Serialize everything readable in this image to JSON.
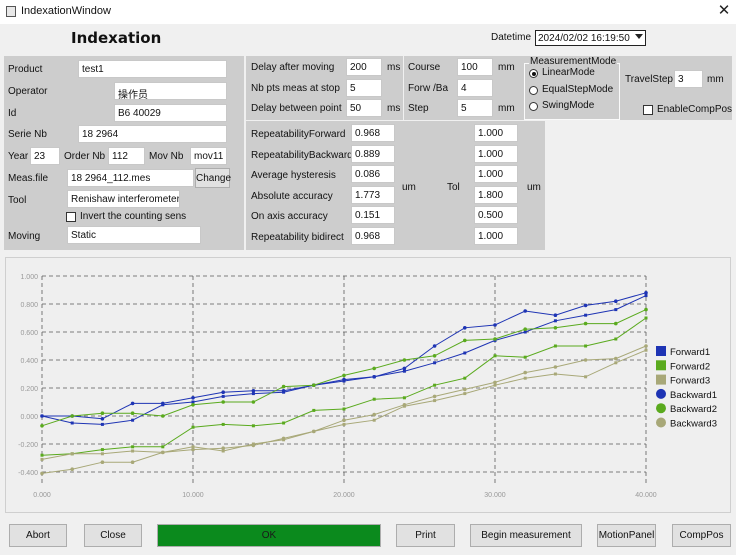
{
  "window": {
    "title": "IndexationWindow",
    "close_glyph": "✕"
  },
  "heading": "Indexation",
  "datetime": {
    "label": "Datetime",
    "value": "2024/02/02 16:19:50"
  },
  "left": {
    "product_label": "Product",
    "product_value": "test1",
    "operator_label": "Operator",
    "operator_value": "操作员",
    "id_label": "Id",
    "id_value": "B6 40029",
    "serie_label": "Serie Nb",
    "serie_value": "18 2964",
    "year_label": "Year",
    "year_value": "23",
    "order_label": "Order Nb",
    "order_value": "112",
    "mov_label": "Mov Nb",
    "mov_value": "mov11",
    "meas_label": "Meas.file",
    "meas_value": "18 2964_112.mes",
    "change_label": "Change",
    "tool_label": "Tool",
    "tool_value": "Renishaw interferometer",
    "invert_label": "Invert the counting sens",
    "invert_checked": false,
    "moving_label": "Moving",
    "moving_value": "Static"
  },
  "params": {
    "delay_moving_label": "Delay after moving",
    "delay_moving_value": "200",
    "nbpts_label": "Nb pts meas at stop",
    "nbpts_value": "5",
    "delay_points_label": "Delay between point",
    "delay_points_value": "50",
    "unit_ms": "ms",
    "course_label": "Course",
    "course_value": "100",
    "forw_label": "Forw  /Ba",
    "forw_value": "4",
    "step_label": "Step",
    "step_value": "5",
    "unit_mm": "mm"
  },
  "mode": {
    "group_label": "MeasurementMode",
    "options": [
      "LinearMode",
      "EqualStepMode",
      "SwingMode"
    ],
    "selected": "LinearMode",
    "travelstep_label": "TravelStep",
    "travelstep_value": "3",
    "travelstep_unit": "mm",
    "enablecomp_label": "EnableCompPos",
    "enablecomp_checked": false
  },
  "results": {
    "rows": [
      {
        "label": "RepeatabilityForward",
        "value": "0.968",
        "tol": "1.000"
      },
      {
        "label": "RepeatabilityBackward",
        "value": "0.889",
        "tol": "1.000"
      },
      {
        "label": "Average hysteresis",
        "value": "0.086",
        "tol": "1.000"
      },
      {
        "label": "Absolute accuracy",
        "value": "1.773",
        "tol": "1.800"
      },
      {
        "label": "On axis accuracy",
        "value": "0.151",
        "tol": "0.500"
      },
      {
        "label": "Repeatability bidirect",
        "value": "0.968",
        "tol": "1.000"
      }
    ],
    "unit": "um",
    "tol_label": "Tol",
    "tol_unit": "um"
  },
  "chart_data": {
    "type": "line",
    "xlim": [
      0,
      40
    ],
    "ylim": [
      -0.5,
      1.0
    ],
    "x_ticks": [
      "0.000",
      "10.000",
      "20.000",
      "30.000",
      "40.000"
    ],
    "y_ticks": [
      "1.000",
      "0.800",
      "0.600",
      "0.400",
      "0.200",
      "0.000",
      "-0.200",
      "-0.400"
    ],
    "grid": true,
    "legend_position": "right",
    "series": [
      {
        "name": "Forward1",
        "marker": "square",
        "color": "#1e34b4",
        "x": [
          0,
          2,
          4,
          6,
          8,
          10,
          12,
          14,
          16,
          18,
          20,
          22,
          24,
          26,
          28,
          30,
          32,
          34,
          36,
          38,
          40
        ],
        "y": [
          0.0,
          -0.05,
          -0.06,
          -0.03,
          0.08,
          0.1,
          0.14,
          0.16,
          0.17,
          0.22,
          0.25,
          0.28,
          0.32,
          0.38,
          0.45,
          0.54,
          0.6,
          0.68,
          0.72,
          0.76,
          0.86
        ]
      },
      {
        "name": "Forward2",
        "marker": "square",
        "color": "#5aaa1e",
        "x": [
          0,
          2,
          4,
          6,
          8,
          10,
          12,
          14,
          16,
          18,
          20,
          22,
          24,
          26,
          28,
          30,
          32,
          34,
          36,
          38,
          40
        ],
        "y": [
          -0.28,
          -0.27,
          -0.24,
          -0.22,
          -0.22,
          -0.08,
          -0.06,
          -0.07,
          -0.05,
          0.04,
          0.05,
          0.12,
          0.13,
          0.22,
          0.27,
          0.43,
          0.42,
          0.5,
          0.5,
          0.55,
          0.7
        ]
      },
      {
        "name": "Forward3",
        "marker": "square",
        "color": "#a8a878",
        "x": [
          0,
          2,
          4,
          6,
          8,
          10,
          12,
          14,
          16,
          18,
          20,
          22,
          24,
          26,
          28,
          30,
          32,
          34,
          36,
          38,
          40
        ],
        "y": [
          -0.31,
          -0.27,
          -0.27,
          -0.25,
          -0.26,
          -0.22,
          -0.25,
          -0.2,
          -0.17,
          -0.11,
          -0.06,
          -0.03,
          0.07,
          0.11,
          0.16,
          0.22,
          0.27,
          0.3,
          0.28,
          0.38,
          0.47
        ]
      },
      {
        "name": "Backward1",
        "marker": "circle",
        "color": "#1e34b4",
        "x": [
          0,
          2,
          4,
          6,
          8,
          10,
          12,
          14,
          16,
          18,
          20,
          22,
          24,
          26,
          28,
          30,
          32,
          34,
          36,
          38,
          40
        ],
        "y": [
          0.0,
          0.0,
          -0.02,
          0.09,
          0.09,
          0.13,
          0.17,
          0.18,
          0.18,
          0.22,
          0.26,
          0.28,
          0.34,
          0.5,
          0.63,
          0.65,
          0.75,
          0.72,
          0.79,
          0.82,
          0.88
        ]
      },
      {
        "name": "Backward2",
        "marker": "circle",
        "color": "#5aaa1e",
        "x": [
          0,
          2,
          4,
          6,
          8,
          10,
          12,
          14,
          16,
          18,
          20,
          22,
          24,
          26,
          28,
          30,
          32,
          34,
          36,
          38,
          40
        ],
        "y": [
          -0.07,
          0.0,
          0.02,
          0.02,
          0.0,
          0.08,
          0.1,
          0.1,
          0.21,
          0.22,
          0.29,
          0.34,
          0.4,
          0.43,
          0.54,
          0.55,
          0.62,
          0.63,
          0.66,
          0.66,
          0.76
        ]
      },
      {
        "name": "Backward3",
        "marker": "circle",
        "color": "#a8a878",
        "x": [
          0,
          2,
          4,
          6,
          8,
          10,
          12,
          14,
          16,
          18,
          20,
          22,
          24,
          26,
          28,
          30,
          32,
          34,
          36,
          38,
          40
        ],
        "y": [
          -0.41,
          -0.38,
          -0.33,
          -0.33,
          -0.26,
          -0.24,
          -0.23,
          -0.21,
          -0.16,
          -0.11,
          -0.03,
          0.01,
          0.08,
          0.14,
          0.19,
          0.24,
          0.31,
          0.35,
          0.4,
          0.41,
          0.5
        ]
      }
    ]
  },
  "buttons": {
    "abort": "Abort",
    "close": "Close",
    "ok": "OK",
    "print": "Print",
    "begin": "Begin measurement",
    "motion": "MotionPanel",
    "comppos": "CompPos"
  },
  "colors": {
    "ok_button": "#0b8a1d",
    "panel": "#cdcdcd",
    "grid": "#5a5a5a"
  }
}
